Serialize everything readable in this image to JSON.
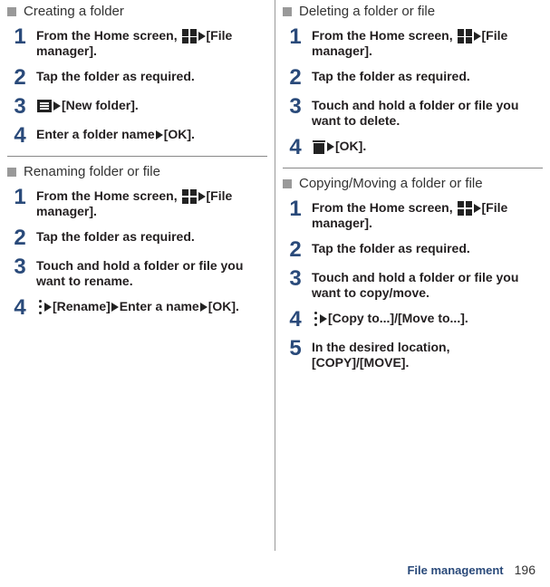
{
  "footer": {
    "label": "File management",
    "page": "196"
  },
  "leftCol": {
    "sections": [
      {
        "title": "Creating a folder",
        "steps": [
          {
            "num": "1",
            "parts": [
              {
                "t": "text",
                "v": "From the Home screen, "
              },
              {
                "t": "icon",
                "v": "grid"
              },
              {
                "t": "tri"
              },
              {
                "t": "text",
                "v": "[File manager]."
              }
            ]
          },
          {
            "num": "2",
            "parts": [
              {
                "t": "text",
                "v": "Tap the folder as required."
              }
            ]
          },
          {
            "num": "3",
            "parts": [
              {
                "t": "icon",
                "v": "menu"
              },
              {
                "t": "tri"
              },
              {
                "t": "text",
                "v": "[New folder]."
              }
            ]
          },
          {
            "num": "4",
            "parts": [
              {
                "t": "text",
                "v": "Enter a folder name"
              },
              {
                "t": "tri"
              },
              {
                "t": "text",
                "v": "[OK]."
              }
            ]
          }
        ]
      },
      {
        "title": "Renaming folder or file",
        "steps": [
          {
            "num": "1",
            "parts": [
              {
                "t": "text",
                "v": "From the Home screen, "
              },
              {
                "t": "icon",
                "v": "grid"
              },
              {
                "t": "tri"
              },
              {
                "t": "text",
                "v": "[File manager]."
              }
            ]
          },
          {
            "num": "2",
            "parts": [
              {
                "t": "text",
                "v": "Tap the folder as required."
              }
            ]
          },
          {
            "num": "3",
            "parts": [
              {
                "t": "text",
                "v": "Touch and hold a folder or file you want to rename."
              }
            ]
          },
          {
            "num": "4",
            "parts": [
              {
                "t": "icon",
                "v": "dots"
              },
              {
                "t": "tri"
              },
              {
                "t": "text",
                "v": "[Rename]"
              },
              {
                "t": "tri"
              },
              {
                "t": "text",
                "v": "Enter a name"
              },
              {
                "t": "tri"
              },
              {
                "t": "text",
                "v": "[OK]."
              }
            ]
          }
        ]
      }
    ]
  },
  "rightCol": {
    "sections": [
      {
        "title": "Deleting a folder or file",
        "steps": [
          {
            "num": "1",
            "parts": [
              {
                "t": "text",
                "v": "From the Home screen, "
              },
              {
                "t": "icon",
                "v": "grid"
              },
              {
                "t": "tri"
              },
              {
                "t": "text",
                "v": "[File manager]."
              }
            ]
          },
          {
            "num": "2",
            "parts": [
              {
                "t": "text",
                "v": "Tap the folder as required."
              }
            ]
          },
          {
            "num": "3",
            "parts": [
              {
                "t": "text",
                "v": "Touch and hold a folder or file you want to delete."
              }
            ]
          },
          {
            "num": "4",
            "parts": [
              {
                "t": "icon",
                "v": "trash"
              },
              {
                "t": "tri"
              },
              {
                "t": "text",
                "v": "[OK]."
              }
            ]
          }
        ]
      },
      {
        "title": "Copying/Moving a folder or file",
        "steps": [
          {
            "num": "1",
            "parts": [
              {
                "t": "text",
                "v": "From the Home screen, "
              },
              {
                "t": "icon",
                "v": "grid"
              },
              {
                "t": "tri"
              },
              {
                "t": "text",
                "v": "[File manager]."
              }
            ]
          },
          {
            "num": "2",
            "parts": [
              {
                "t": "text",
                "v": "Tap the folder as required."
              }
            ]
          },
          {
            "num": "3",
            "parts": [
              {
                "t": "text",
                "v": "Touch and hold a folder or file you want to copy/move."
              }
            ]
          },
          {
            "num": "4",
            "parts": [
              {
                "t": "icon",
                "v": "dots"
              },
              {
                "t": "tri"
              },
              {
                "t": "text",
                "v": "[Copy to...]/[Move to...]."
              }
            ]
          },
          {
            "num": "5",
            "parts": [
              {
                "t": "text",
                "v": "In the desired location, [COPY]/[MOVE]."
              }
            ]
          }
        ]
      }
    ]
  }
}
